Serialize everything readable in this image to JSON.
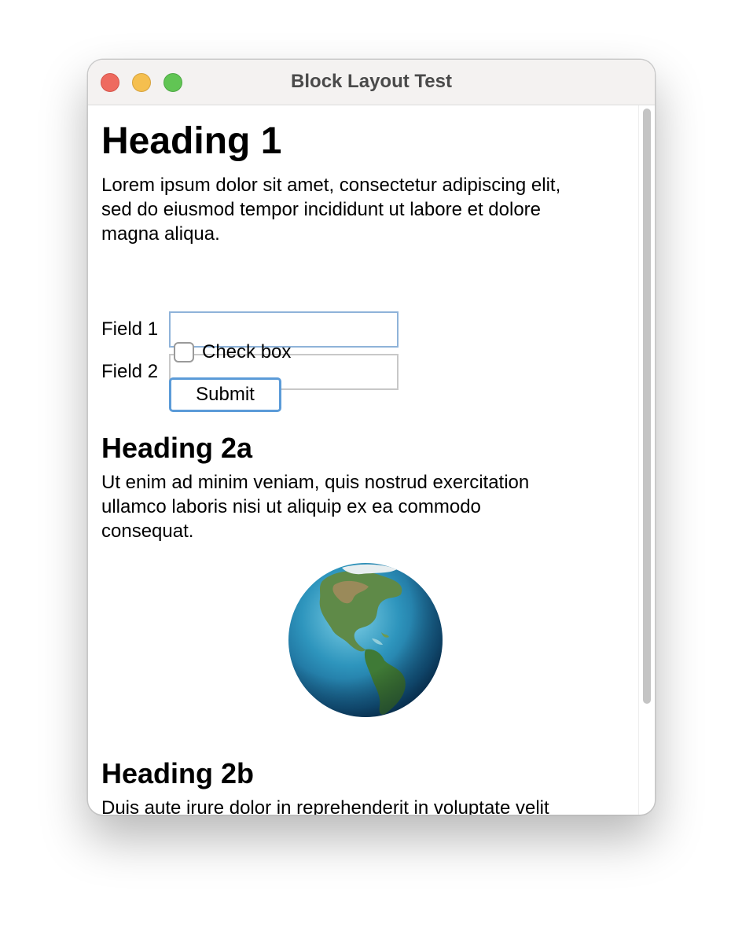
{
  "window": {
    "title": "Block Layout Test"
  },
  "content": {
    "heading1": "Heading 1",
    "paragraph1_lines": [
      "Lorem ipsum dolor sit amet, consectetur adipiscing elit,",
      "sed do eiusmod tempor incididunt ut labore et dolore",
      "magna aliqua."
    ],
    "form": {
      "field1_label": "Field 1",
      "field1_value": "",
      "field2_label": "Field 2",
      "field2_value": "",
      "checkbox_label": "Check box",
      "checkbox_checked": false,
      "submit_label": "Submit"
    },
    "heading2a": "Heading 2a",
    "paragraph2_lines": [
      "Ut enim ad minim veniam, quis nostrud exercitation",
      "ullamco laboris nisi ut aliquip ex ea commodo",
      "consequat."
    ],
    "image_icon": "earth-globe-icon",
    "heading2b": "Heading 2b",
    "paragraph3_lines": [
      "Duis aute irure dolor in reprehenderit in voluptate velit"
    ]
  },
  "colors": {
    "focus_border": "#8fb3d9",
    "button_border": "#5b9bd8",
    "close": "#ee6a5f",
    "minimize": "#f5bf4f",
    "maximize": "#61c554"
  }
}
